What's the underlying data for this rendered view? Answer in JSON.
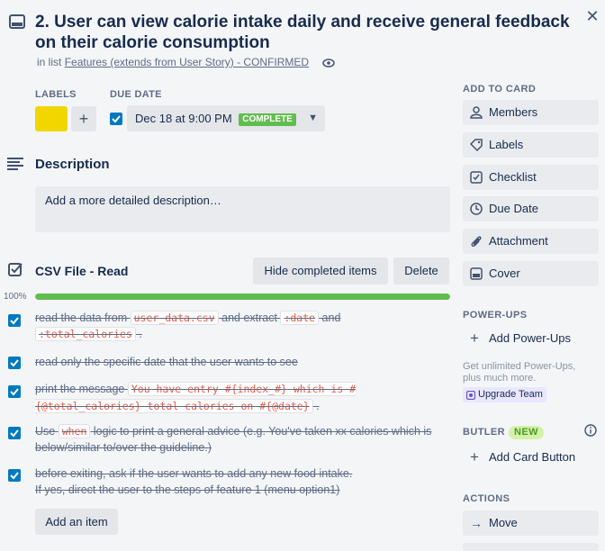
{
  "card": {
    "title": "2. User can view calorie intake daily and receive general feedback on their calorie consumption",
    "in_list_prefix": "in list",
    "list_name": "Features (extends from User Story) - CONFIRMED"
  },
  "labels": {
    "heading": "LABELS",
    "color": "#f2d600",
    "add": "+"
  },
  "due": {
    "heading": "DUE DATE",
    "value": "Dec 18 at 9:00 PM",
    "badge": "COMPLETE",
    "checked": true
  },
  "description": {
    "heading": "Description",
    "placeholder": "Add a more detailed description…"
  },
  "checklist": {
    "title": "CSV File - Read",
    "hide_label": "Hide completed items",
    "delete_label": "Delete",
    "progress_label": "100%",
    "progress": 1.0,
    "items": [
      {
        "parts": [
          "read the data from ",
          "user_data.csv",
          " and extract ",
          ":date",
          " and ",
          ":total_calories",
          " ."
        ]
      },
      {
        "parts": [
          "read only the specific date that the user wants to see"
        ]
      },
      {
        "parts": [
          "print the message ",
          "You have entry #{index_#} which is #{@total_calories} total calories on #{@date}",
          " ."
        ]
      },
      {
        "parts": [
          "Use ",
          "when",
          " logic to print a general advice (e.g. You've taken xx calories which is below/similar to/over the guideline.)"
        ]
      },
      {
        "parts": [
          "before exiting, ask if the user wants to add any new food intake.",
          "If yes, direct the user to the steps of feature 1 (menu option1)"
        ]
      }
    ],
    "add_item": "Add an item"
  },
  "sidebar": {
    "add_to_card": "ADD TO CARD",
    "buttons": [
      "Members",
      "Labels",
      "Checklist",
      "Due Date",
      "Attachment",
      "Cover"
    ],
    "powerups_heading": "POWER-UPS",
    "add_powerups": "Add Power-Ups",
    "unlimited_1": "Get unlimited Power-Ups,",
    "unlimited_2": "plus much more.",
    "upgrade": "Upgrade Team",
    "butler_heading": "BUTLER",
    "butler_badge": "NEW",
    "add_card_button": "Add Card Button",
    "actions_heading": "ACTIONS",
    "move": "Move"
  },
  "colors": {
    "accent": "#0079bf",
    "complete": "#61bd4f",
    "code": "#eb5a46"
  }
}
